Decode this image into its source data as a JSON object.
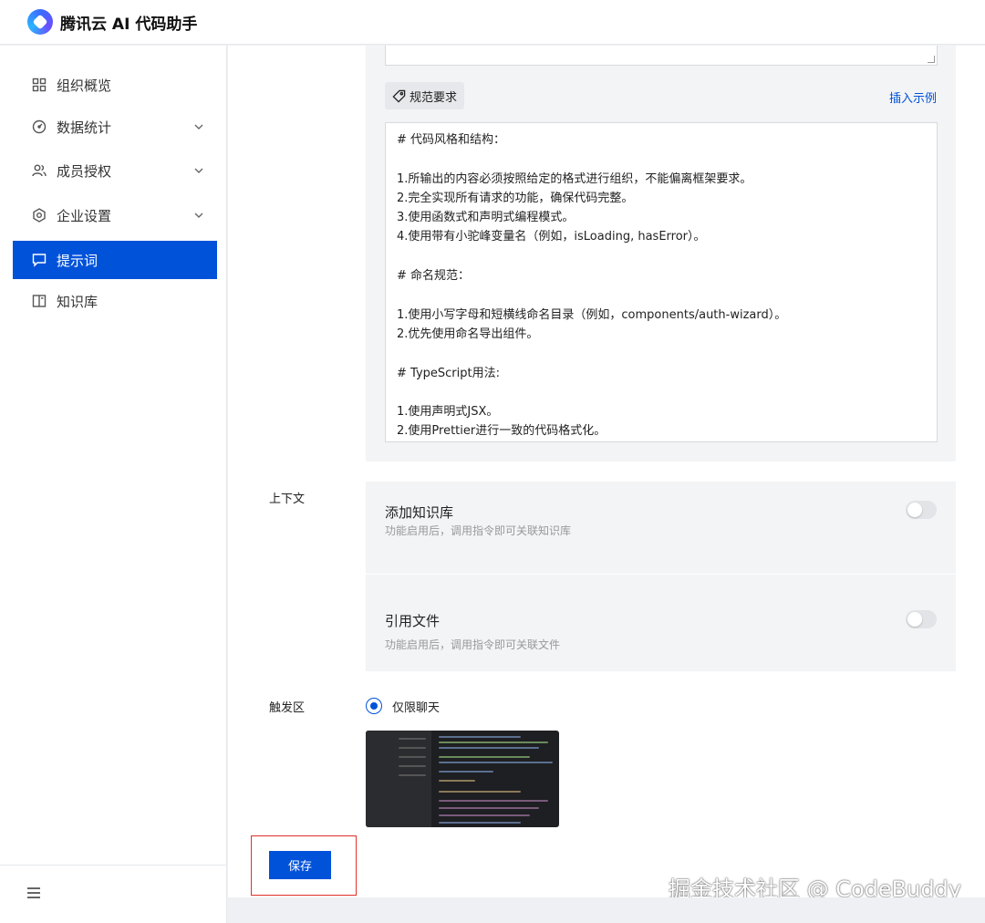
{
  "app": {
    "brand": "腾讯云 AI 代码助手"
  },
  "sidebar": {
    "items": [
      {
        "label": "组织概览",
        "icon": "grid-icon"
      },
      {
        "label": "数据统计",
        "icon": "dashboard-icon"
      },
      {
        "label": "成员授权",
        "icon": "users-icon"
      },
      {
        "label": "企业设置",
        "icon": "hexagon-settings-icon"
      },
      {
        "label": "提示词",
        "icon": "message-icon"
      },
      {
        "label": "知识库",
        "icon": "book-icon"
      }
    ],
    "active": "提示词"
  },
  "spec": {
    "tag_label": "规范要求",
    "insert_link": "插入示例",
    "lines": [
      "# 代码风格和结构：",
      "",
      "1.所输出的内容必须按照给定的格式进行组织，不能偏离框架要求。",
      "2.完全实现所有请求的功能，确保代码完整。",
      "3.使用函数式和声明式编程模式。",
      "4.使用带有小驼峰变量名（例如，isLoading, hasError）。",
      "",
      "# 命名规范：",
      "",
      "1.使用小写字母和短横线命名目录（例如，components/auth-wizard）。",
      "2.优先使用命名导出组件。",
      "",
      "# TypeScript用法:",
      "",
      "1.使用声明式JSX。",
      "2.使用Prettier进行一致的代码格式化。"
    ]
  },
  "context": {
    "label": "上下文",
    "knowledge": {
      "title": "添加知识库",
      "desc": "功能启用后，调用指令即可关联知识库",
      "enabled": false
    },
    "file": {
      "title": "引用文件",
      "desc": "功能启用后，调用指令即可关联文件",
      "enabled": false
    }
  },
  "trigger": {
    "label": "触发区",
    "option": "仅限聊天",
    "selected": true
  },
  "actions": {
    "save": "保存"
  },
  "watermark": "掘金技术社区 @ CodeBuddy",
  "colors": {
    "primary": "#0052d9",
    "highlight_border": "#e0302a"
  }
}
